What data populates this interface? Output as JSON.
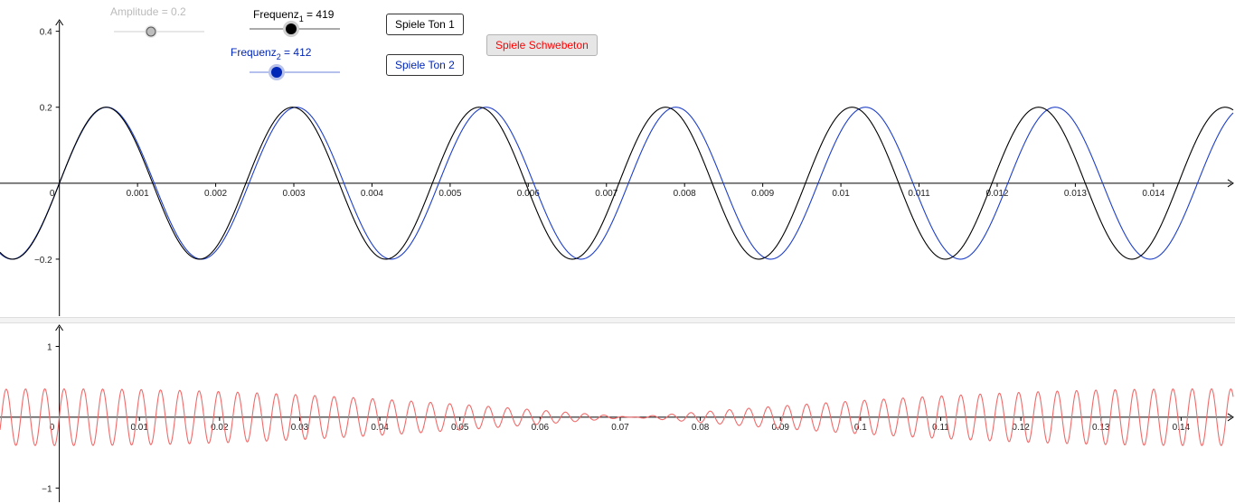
{
  "sliders": {
    "amplitude": {
      "label_text": "Amplitude = 0.2",
      "value": 0.2,
      "color": "#bbbbbb"
    },
    "freq1": {
      "name": "Frequenz",
      "sub": "1",
      "value_text": " = 419",
      "value": 419,
      "color": "#000000"
    },
    "freq2": {
      "name": "Frequenz",
      "sub": "2",
      "value_text": " = 412",
      "value": 412,
      "color": "#0026b8"
    }
  },
  "buttons": {
    "ton1": "Spiele Ton 1",
    "ton2": "Spiele Ton 2",
    "beat": "Spiele Schwebeton"
  },
  "colors": {
    "tone1": "#000000",
    "tone2": "#1e3fc9",
    "beat": "#f06a6a",
    "beat_button_text": "#ff0000"
  },
  "plot_top": {
    "x_ticks": [
      "0",
      "0.001",
      "0.002",
      "0.003",
      "0.004",
      "0.005",
      "0.006",
      "0.007",
      "0.008",
      "0.009",
      "0.01",
      "0.011",
      "0.012",
      "0.013",
      "0.014"
    ],
    "y_ticks": [
      "0.4",
      "0.2",
      "−0.2"
    ]
  },
  "plot_bottom": {
    "x_ticks": [
      "0",
      "0.01",
      "0.02",
      "0.03",
      "0.04",
      "0.05",
      "0.06",
      "0.07",
      "0.08",
      "0.09",
      "0.1",
      "0.11",
      "0.12",
      "0.13",
      "0.14"
    ],
    "y_ticks": [
      "1",
      "−1"
    ]
  },
  "chart_data": [
    {
      "type": "line",
      "series": [
        {
          "formula": "0.2·sin(2π·419·x)",
          "amplitude": 0.2,
          "frequency": 419
        },
        {
          "formula": "0.2·sin(2π·412·x)",
          "amplitude": 0.2,
          "frequency": 412
        }
      ],
      "xlim": [
        -0.00076,
        0.01502
      ],
      "ylim": [
        -0.35,
        0.43
      ],
      "grid": false
    },
    {
      "type": "line",
      "series": [
        {
          "formula": "0.2·sin(2π·419·x) + 0.2·sin(2π·412·x)",
          "amplitude": 0.2,
          "frequencies": [
            419,
            412
          ]
        }
      ],
      "xlim": [
        -0.0074,
        0.1465
      ],
      "ylim": [
        -1.2,
        1.3
      ],
      "grid": false
    }
  ]
}
